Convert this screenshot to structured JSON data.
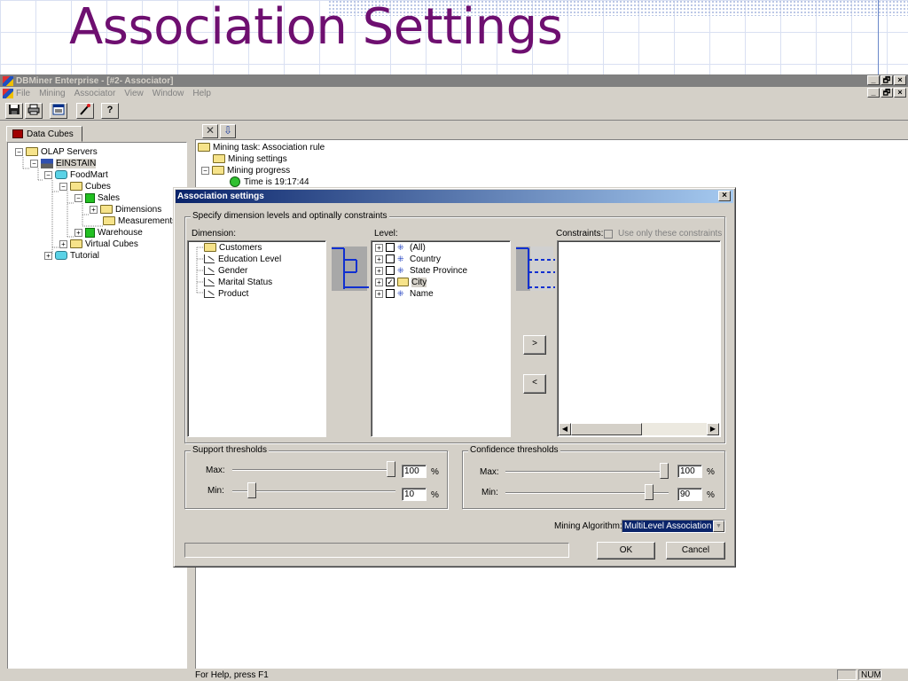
{
  "slide": {
    "title": "Association Settings"
  },
  "app": {
    "window_title": "DBMiner Enterprise - [#2- Associator]",
    "menu": [
      "File",
      "Mining",
      "Associator",
      "View",
      "Window",
      "Help"
    ],
    "window_buttons": [
      "_",
      "🗗",
      "×"
    ],
    "toolbar_icons": [
      "save-icon",
      "print-icon",
      "properties-icon",
      "wand-icon",
      "help-icon"
    ],
    "toolbar_help_label": "?"
  },
  "left_pane": {
    "tab_label": "Data Cubes",
    "tree": [
      {
        "label": "OLAP Servers",
        "icon": "folder-icon",
        "expander": "−"
      },
      {
        "label": "EINSTAIN",
        "icon": "server-icon",
        "expander": "−"
      },
      {
        "label": "FoodMart",
        "icon": "database-icon",
        "expander": "−"
      },
      {
        "label": "Cubes",
        "icon": "folder-icon",
        "expander": "−"
      },
      {
        "label": "Sales",
        "icon": "cube-icon",
        "expander": "−"
      },
      {
        "label": "Dimensions",
        "icon": "folder-icon",
        "expander": "+"
      },
      {
        "label": "Measurements",
        "icon": "folder-icon",
        "expander": ""
      },
      {
        "label": "Warehouse",
        "icon": "cube-icon",
        "expander": "+"
      },
      {
        "label": "Virtual Cubes",
        "icon": "folder-icon",
        "expander": "+"
      },
      {
        "label": "Tutorial",
        "icon": "database-icon",
        "expander": "+"
      }
    ]
  },
  "right_pane": {
    "tree": [
      {
        "label": "Mining task: Association rule",
        "icon": "folder-icon"
      },
      {
        "label": "Mining settings",
        "icon": "folder-icon"
      },
      {
        "label": "Mining progress",
        "icon": "folder-icon",
        "expander": "−"
      },
      {
        "label": "Time is 19:17:44",
        "icon": "clock-icon"
      }
    ]
  },
  "dialog": {
    "title": "Association settings",
    "close_label": "×",
    "group_dimension": "Specify dimension levels and optinally constraints",
    "dimension_label": "Dimension:",
    "level_label": "Level:",
    "constraints_label": "Constraints:",
    "use_only_label": "Use only these constraints",
    "dimensions": [
      "Customers",
      "Education Level",
      "Gender",
      "Marital Status",
      "Product"
    ],
    "levels": [
      {
        "label": "(All)",
        "checked": false
      },
      {
        "label": "Country",
        "checked": false
      },
      {
        "label": "State Province",
        "checked": false
      },
      {
        "label": "City",
        "checked": true
      },
      {
        "label": "Name",
        "checked": false
      }
    ],
    "add_button": ">",
    "remove_button": "<",
    "support": {
      "label": "Support thresholds",
      "max_label": "Max:",
      "min_label": "Min:",
      "max_value": "100",
      "min_value": "10",
      "unit": "%",
      "max_level": 1.0,
      "min_level": 0.1
    },
    "confidence": {
      "label": "Confidence thresholds",
      "max_label": "Max:",
      "min_label": "Min:",
      "max_value": "100",
      "min_value": "90",
      "unit": "%",
      "max_level": 1.0,
      "min_level": 0.9
    },
    "algorithm_label": "Mining Algorithm:",
    "algorithm_value": "MultiLevel Association",
    "ok_label": "OK",
    "cancel_label": "Cancel",
    "accent": "#0a246a"
  },
  "statusbar": {
    "help_text": "For Help, press F1",
    "num_indicator": "NUM"
  }
}
